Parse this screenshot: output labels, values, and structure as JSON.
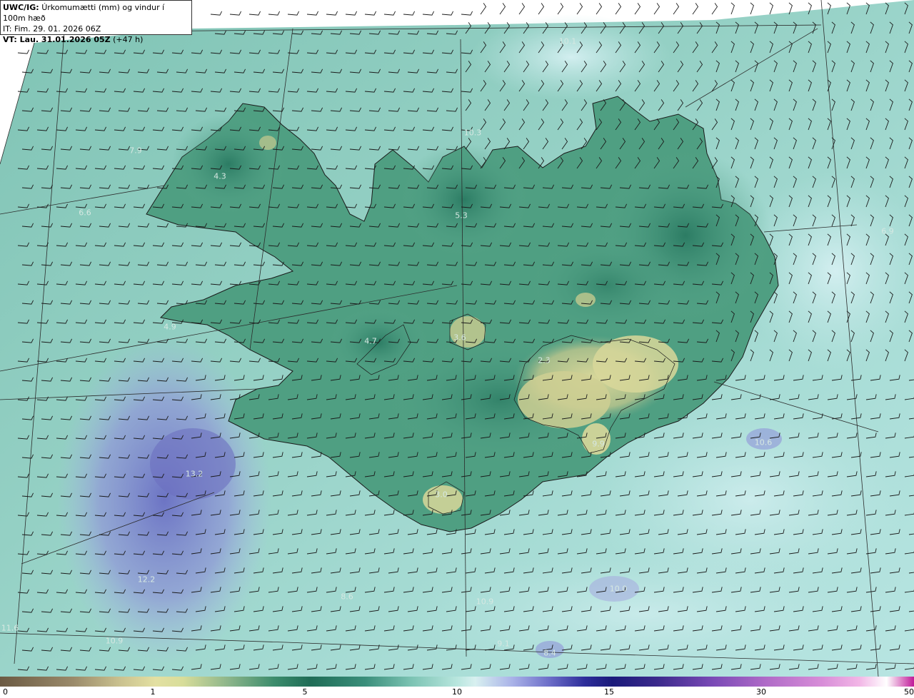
{
  "header": {
    "model": "UWC/IG:",
    "title": "Úrkomumætti (mm) og vindur í 100m hæð",
    "initial_time": "IT: Fim. 29. 01. 2026 06Z",
    "valid_label": "VT: Lau. 31.01.2026 05Z",
    "valid_offset": " (+47 h)"
  },
  "colorbar": {
    "ticks": [
      "0",
      "1",
      "5",
      "10",
      "15",
      "30",
      "50"
    ]
  },
  "labels": [
    "7.9",
    "4.3",
    "6.6",
    "10.1",
    "10.3",
    "5.3",
    "6.9",
    "4.9",
    "4.7",
    "3.6",
    "2.3",
    "9.9",
    "10.6",
    "13.2",
    "3.0",
    "12.2",
    "8.6",
    "10.0",
    "10.9",
    "11.6",
    "10.9",
    "9.1",
    "8.4"
  ],
  "colors": {
    "ocean": "#a9ded8",
    "land_dark": "#2e7d66",
    "glacier_yellow": "#c9c98e",
    "purple_precip": "#8a8fd6",
    "coastline": "#1a1a1a"
  }
}
